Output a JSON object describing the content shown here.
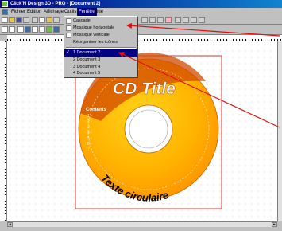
{
  "window": {
    "title": "Click'N Design 3D - PRO - [Document 2]"
  },
  "menubar": {
    "items": [
      "Fichier",
      "Edition",
      "Affichage",
      "Outils",
      "Fenêtre",
      "Aide"
    ],
    "active_index": 4
  },
  "toolbar1": {
    "buttons": [
      "new-icon",
      "open-icon",
      "save-icon",
      "print-icon",
      "cut-icon",
      "copy-icon",
      "paste-icon",
      "undo-icon"
    ]
  },
  "toolbar2": {
    "buttons": [
      "add-icon",
      "grid-icon",
      "text-icon",
      "image-icon",
      "line-icon",
      "shape-icon",
      "fill-icon",
      "color-icon"
    ]
  },
  "window_menu": {
    "items": [
      {
        "label": "Cascade",
        "icon": "cascade-icon"
      },
      {
        "label": "Mosaique horizontale",
        "icon": "tile-horizontal-icon"
      },
      {
        "label": "Mosaique verticale",
        "icon": "tile-vertical-icon"
      },
      {
        "label": "Réorganiser les icônes",
        "icon": ""
      }
    ],
    "documents": [
      {
        "label": "1 Document 2",
        "checked": true
      },
      {
        "label": "2 Document 3",
        "checked": false
      },
      {
        "label": "3 Document 4",
        "checked": false
      },
      {
        "label": "4 Document 5",
        "checked": false
      }
    ],
    "check_mark": "✓"
  },
  "cd": {
    "title": "CD Title",
    "contents_heading": "Contents",
    "contents_items": [
      "1 -",
      "2 -",
      "3 -",
      "4 -",
      "5 -",
      "6 -",
      "7 -"
    ],
    "curved_text": "Texte circulaire",
    "colors": {
      "inner": "#ffd21a",
      "outer": "#ff8c00",
      "accent": "#e85a00"
    }
  },
  "annotation": {
    "arrow_color": "#e01010"
  }
}
